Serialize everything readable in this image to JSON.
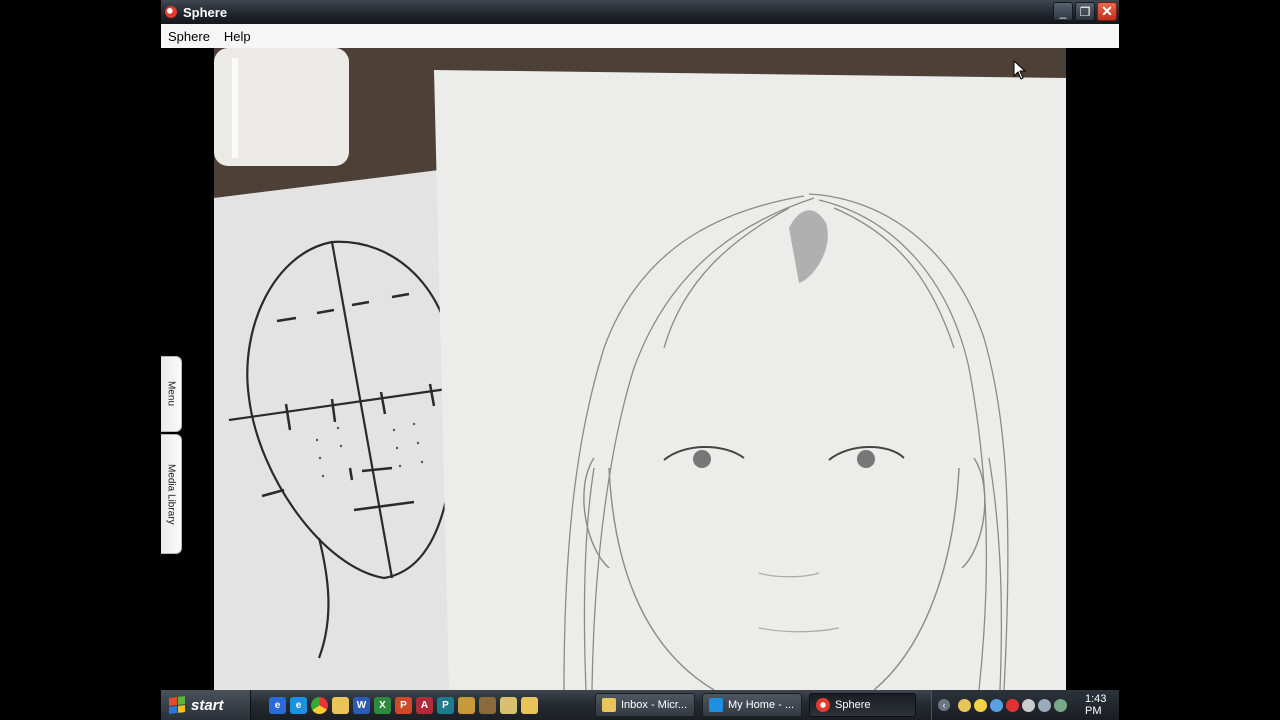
{
  "window": {
    "title": "Sphere",
    "controls": {
      "minimize": "_",
      "restore": "❐",
      "close": "✕"
    }
  },
  "menubar": {
    "items": [
      "Sphere",
      "Help"
    ]
  },
  "side_tabs": [
    "Menu",
    "Media Library"
  ],
  "taskbar": {
    "start_label": "start",
    "quick_launch": [
      "outlook-icon",
      "ie-icon",
      "chrome-icon",
      "folder-icon",
      "word-icon",
      "excel-icon",
      "powerpoint-icon",
      "access-icon",
      "publisher-icon",
      "app-icon",
      "app-icon",
      "app-icon",
      "app-icon"
    ],
    "tasks": [
      {
        "label": "Inbox - Micr...",
        "icon": "folder-icon",
        "active": false
      },
      {
        "label": "My Home - ...",
        "icon": "ie-icon",
        "active": false
      },
      {
        "label": "Sphere",
        "icon": "sphere-icon",
        "active": true
      }
    ],
    "clock": "1:43 PM"
  }
}
